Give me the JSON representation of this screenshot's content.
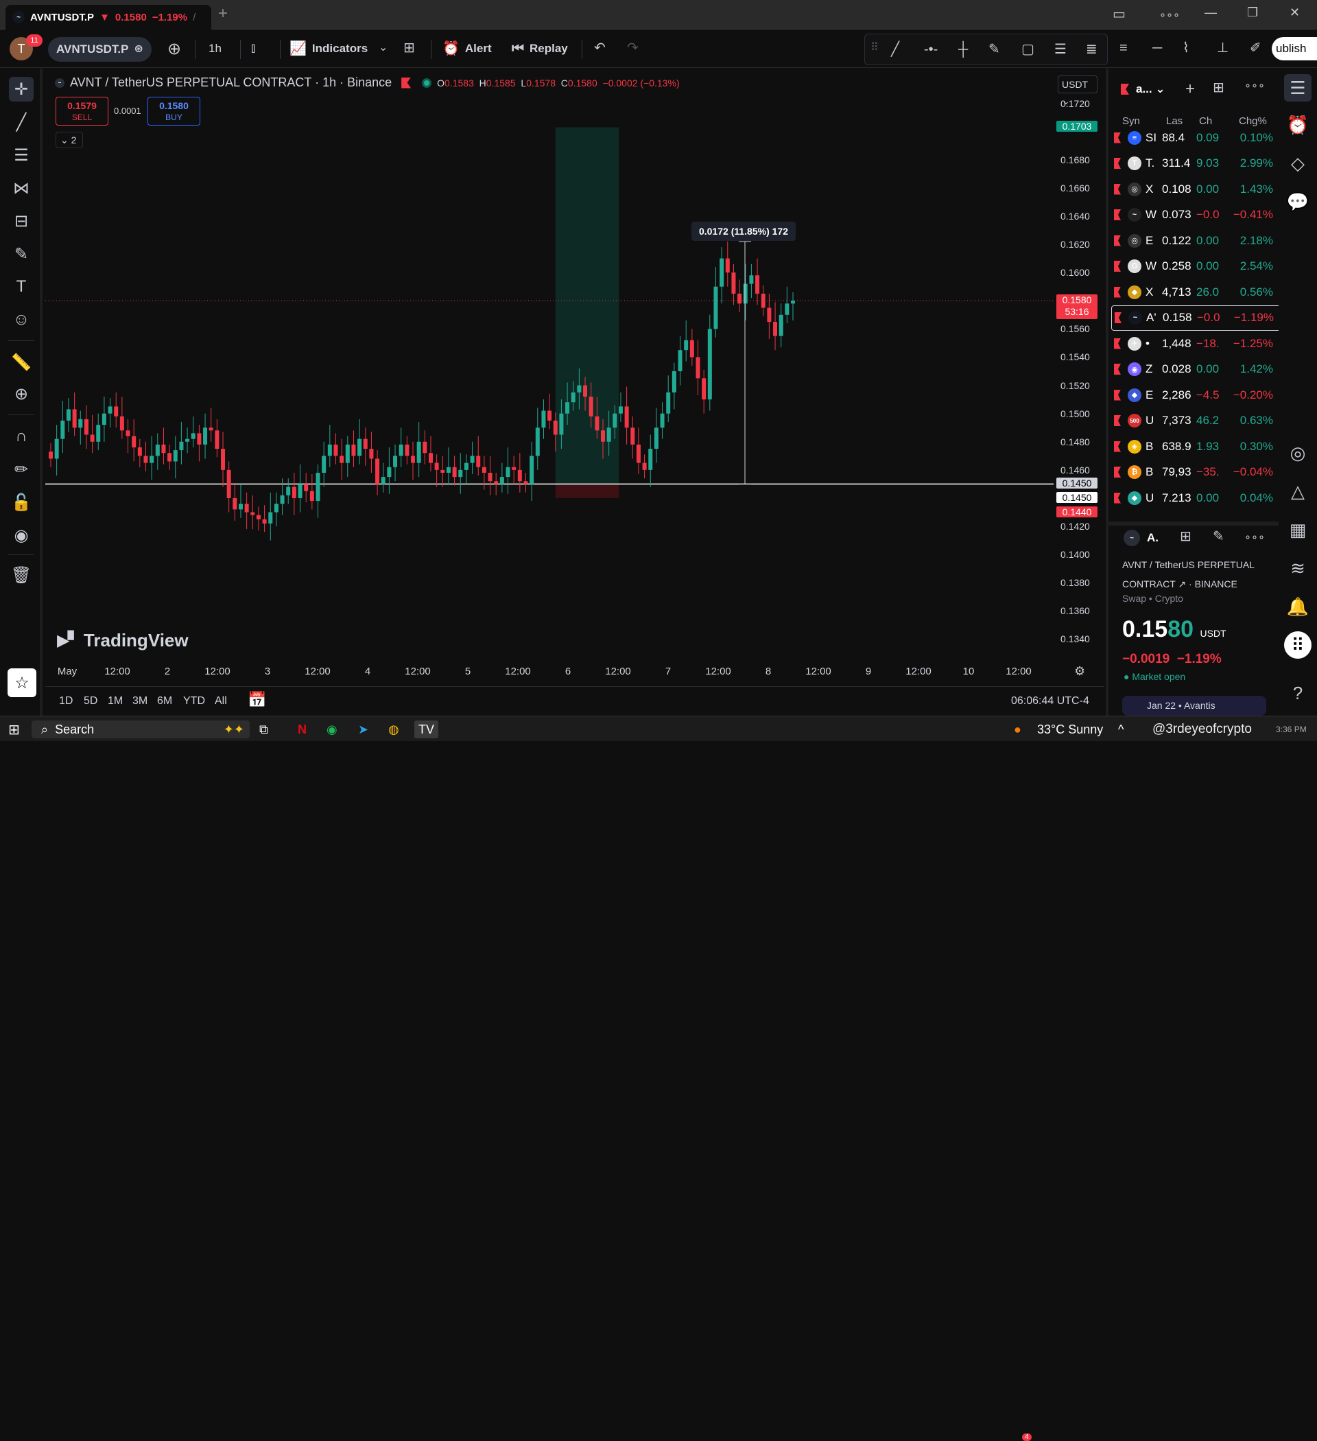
{
  "browser_tab": {
    "title": "AVNTUSDT.P",
    "price": "0.1580",
    "change": "−1.19%",
    "slash": "/"
  },
  "toolbar": {
    "avatar": "T",
    "badge": "11",
    "symbol": "AVNTUSDT.P",
    "interval": "1h",
    "indicators": "Indicators",
    "alert": "Alert",
    "replay": "Replay",
    "publish": "ublish"
  },
  "legend": {
    "title": "AVNT / TetherUS PERPETUAL CONTRACT · 1h · Binance",
    "o_lbl": "O",
    "o": "0.1583",
    "h_lbl": "H",
    "h": "0.1585",
    "l_lbl": "L",
    "l": "0.1578",
    "c_lbl": "C",
    "c": "0.1580",
    "chg": "−0.0002 (−0.13%)"
  },
  "trade": {
    "sell_price": "0.1579",
    "sell_label": "SELL",
    "spread": "0.0001",
    "buy_price": "0.1580",
    "buy_label": "BUY",
    "collapse": "2"
  },
  "currency": "USDT",
  "measure_label": "0.0172 (11.85%) 172",
  "price_axis": {
    "labels": [
      "0.1720",
      "0.1680",
      "0.1660",
      "0.1640",
      "0.1620",
      "0.1600",
      "0.1560",
      "0.1540",
      "0.1520",
      "0.1500",
      "0.1480",
      "0.1460",
      "0.1420",
      "0.1400",
      "0.1380",
      "0.1360",
      "0.1340"
    ],
    "tag_top": "0.1703",
    "tag_last": "0.1580",
    "tag_countdown": "53:16",
    "tag_line": "0.1450",
    "tag_cursor": "0.1450",
    "tag_low": "0.1440"
  },
  "time_axis": [
    "May",
    "12:00",
    "2",
    "12:00",
    "3",
    "12:00",
    "4",
    "12:00",
    "5",
    "12:00",
    "6",
    "12:00",
    "7",
    "12:00",
    "8",
    "12:00",
    "9",
    "12:00",
    "10",
    "12:00"
  ],
  "watermark": "TradingView",
  "ranges": [
    "1D",
    "5D",
    "1M",
    "3M",
    "6M",
    "YTD",
    "All"
  ],
  "clock": "06:06:44 UTC-4",
  "watchlist": {
    "list_name": "a...",
    "headers": {
      "sym": "Syn",
      "last": "Las",
      "ch": "Ch",
      "chgp": "Chg%"
    },
    "rows": [
      {
        "icon": "≡",
        "sym": "SI",
        "last": "88.4",
        "ch": "0.09",
        "chgp": "0.10%",
        "dir": "pos",
        "color": "#2962ff"
      },
      {
        "icon": "T",
        "sym": "T.",
        "last": "311.4",
        "ch": "9.03",
        "chgp": "2.99%",
        "dir": "pos",
        "color": "#e0e0e0"
      },
      {
        "icon": "◎",
        "sym": "X",
        "last": "0.108",
        "ch": "0.00",
        "chgp": "1.43%",
        "dir": "pos",
        "color": "#333"
      },
      {
        "icon": "~",
        "sym": "W",
        "last": "0.073",
        "ch": "−0.0",
        "chgp": "−0.41%",
        "dir": "neg",
        "color": "#222"
      },
      {
        "icon": "◎",
        "sym": "E",
        "last": "0.122",
        "ch": "0.00",
        "chgp": "2.18%",
        "dir": "pos",
        "color": "#333"
      },
      {
        "icon": "G",
        "sym": "W",
        "last": "0.258",
        "ch": "0.00",
        "chgp": "2.54%",
        "dir": "pos",
        "color": "#e0e0e0"
      },
      {
        "icon": "◆",
        "sym": "X",
        "last": "4,713",
        "ch": "26.0",
        "chgp": "0.56%",
        "dir": "pos",
        "color": "#d4a017"
      },
      {
        "icon": "~",
        "sym": "A'",
        "last": "0.158",
        "ch": "−0.0",
        "chgp": "−1.19%",
        "dir": "neg",
        "color": "#131722"
      },
      {
        "icon": "✈",
        "sym": "•",
        "last": "1,448",
        "ch": "−18.",
        "chgp": "−1.25%",
        "dir": "neg",
        "color": "#e0e0e0"
      },
      {
        "icon": "◉",
        "sym": "Z",
        "last": "0.028",
        "ch": "0.00",
        "chgp": "1.42%",
        "dir": "pos",
        "color": "#7b61ff"
      },
      {
        "icon": "◆",
        "sym": "E",
        "last": "2,286",
        "ch": "−4.5",
        "chgp": "−0.20%",
        "dir": "neg",
        "color": "#3c5ad6"
      },
      {
        "icon": "500",
        "sym": "U",
        "last": "7,373",
        "ch": "46.2",
        "chgp": "0.63%",
        "dir": "pos",
        "color": "#d32f2f"
      },
      {
        "icon": "◈",
        "sym": "B",
        "last": "638.9",
        "ch": "1.93",
        "chgp": "0.30%",
        "dir": "pos",
        "color": "#f0b90b"
      },
      {
        "icon": "₿",
        "sym": "B",
        "last": "79,93",
        "ch": "−35.",
        "chgp": "−0.04%",
        "dir": "neg",
        "color": "#f7931a"
      },
      {
        "icon": "◆",
        "sym": "U",
        "last": "7.213",
        "ch": "0.00",
        "chgp": "0.04%",
        "dir": "pos",
        "color": "#26a69a"
      }
    ]
  },
  "details": {
    "short": "A.",
    "name_line1": "AVNT / TetherUS PERPETUAL",
    "name_line2": "CONTRACT",
    "exchange": "BINANCE",
    "type": "Swap",
    "category": "Crypto",
    "price_main": "0.15",
    "price_tail": "80",
    "currency": "USDT",
    "change": "−0.0019",
    "change_pct": "−1.19%",
    "status": "Market open",
    "news_date": "Jan 22",
    "news_src": "Avantis"
  },
  "taskbar": {
    "search": "Search",
    "weather_badge": "4",
    "weather": "33°C Sunny",
    "watermark": "@3rdeyeofcrypto",
    "time": "3:36 PM"
  },
  "chart_data": {
    "type": "candlestick",
    "symbol": "AVNTUSDT.P",
    "interval": "1h",
    "ylim": [
      0.133,
      0.173
    ],
    "last": 0.158,
    "horizontal_line": 0.145,
    "position_zone": {
      "entry": 0.145,
      "target": 0.1703,
      "stop": 0.144
    },
    "measure": {
      "from": 0.145,
      "to": 0.1622,
      "label": "0.0172 (11.85%) 172"
    },
    "closes": [
      0.1468,
      0.1482,
      0.1495,
      0.1503,
      0.149,
      0.1496,
      0.1485,
      0.148,
      0.1492,
      0.15,
      0.1505,
      0.1498,
      0.1488,
      0.1484,
      0.1476,
      0.147,
      0.1465,
      0.147,
      0.1478,
      0.1472,
      0.1466,
      0.1474,
      0.148,
      0.1482,
      0.1486,
      0.1478,
      0.149,
      0.1488,
      0.1475,
      0.146,
      0.144,
      0.1432,
      0.1436,
      0.143,
      0.1428,
      0.1425,
      0.1422,
      0.143,
      0.1436,
      0.1442,
      0.1448,
      0.144,
      0.145,
      0.1445,
      0.1438,
      0.1458,
      0.147,
      0.1478,
      0.147,
      0.1465,
      0.1478,
      0.147,
      0.1482,
      0.1475,
      0.1468,
      0.145,
      0.1455,
      0.1462,
      0.147,
      0.1478,
      0.147,
      0.1465,
      0.148,
      0.1472,
      0.1465,
      0.146,
      0.1458,
      0.1462,
      0.1455,
      0.146,
      0.1465,
      0.147,
      0.1462,
      0.1458,
      0.1452,
      0.145,
      0.1455,
      0.1462,
      0.146,
      0.1452,
      0.145,
      0.147,
      0.149,
      0.1502,
      0.1495,
      0.1485,
      0.15,
      0.1508,
      0.1515,
      0.152,
      0.1512,
      0.1498,
      0.1488,
      0.148,
      0.149,
      0.15,
      0.1505,
      0.149,
      0.1478,
      0.1465,
      0.146,
      0.1475,
      0.149,
      0.15,
      0.1515,
      0.153,
      0.1545,
      0.1552,
      0.154,
      0.1525,
      0.151,
      0.156,
      0.159,
      0.161,
      0.16,
      0.1585,
      0.1578,
      0.1592,
      0.1598,
      0.1585,
      0.1575,
      0.1565,
      0.1555,
      0.157,
      0.1578,
      0.158
    ]
  }
}
